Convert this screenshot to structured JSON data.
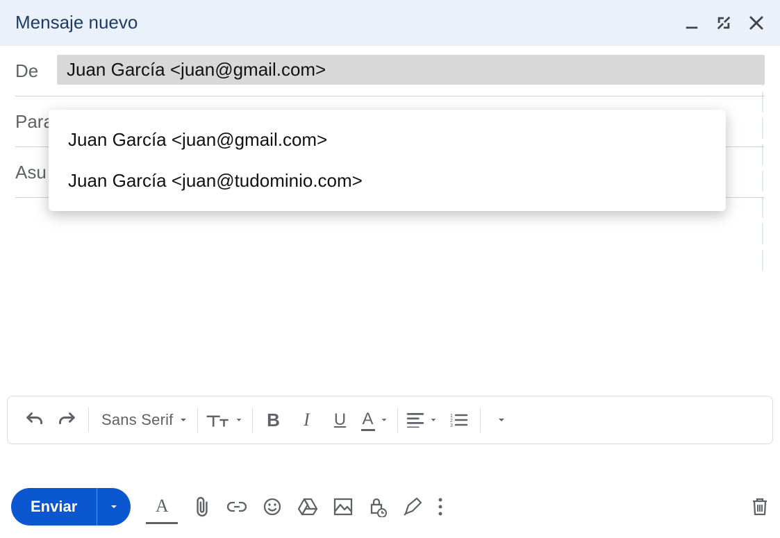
{
  "header": {
    "title": "Mensaje nuevo"
  },
  "windowButtons": {
    "minimize": "minimize",
    "fullscreen": "fullscreen",
    "close": "close"
  },
  "fields": {
    "fromLabel": "De",
    "fromSelected": "Juan García <juan@gmail.com>",
    "toLabel": "Para",
    "subjectLabel": "Asu"
  },
  "fromDropdown": {
    "options": [
      "Juan García <juan@gmail.com>",
      "Juan García <juan@tudominio.com>"
    ]
  },
  "format": {
    "font": "Sans Serif"
  },
  "send": {
    "label": "Enviar"
  },
  "formatA": {
    "letter": "A"
  },
  "colors": {
    "accent": "#0b57d0",
    "titlebar": "#eaf1fb",
    "muted": "#5f6368"
  }
}
